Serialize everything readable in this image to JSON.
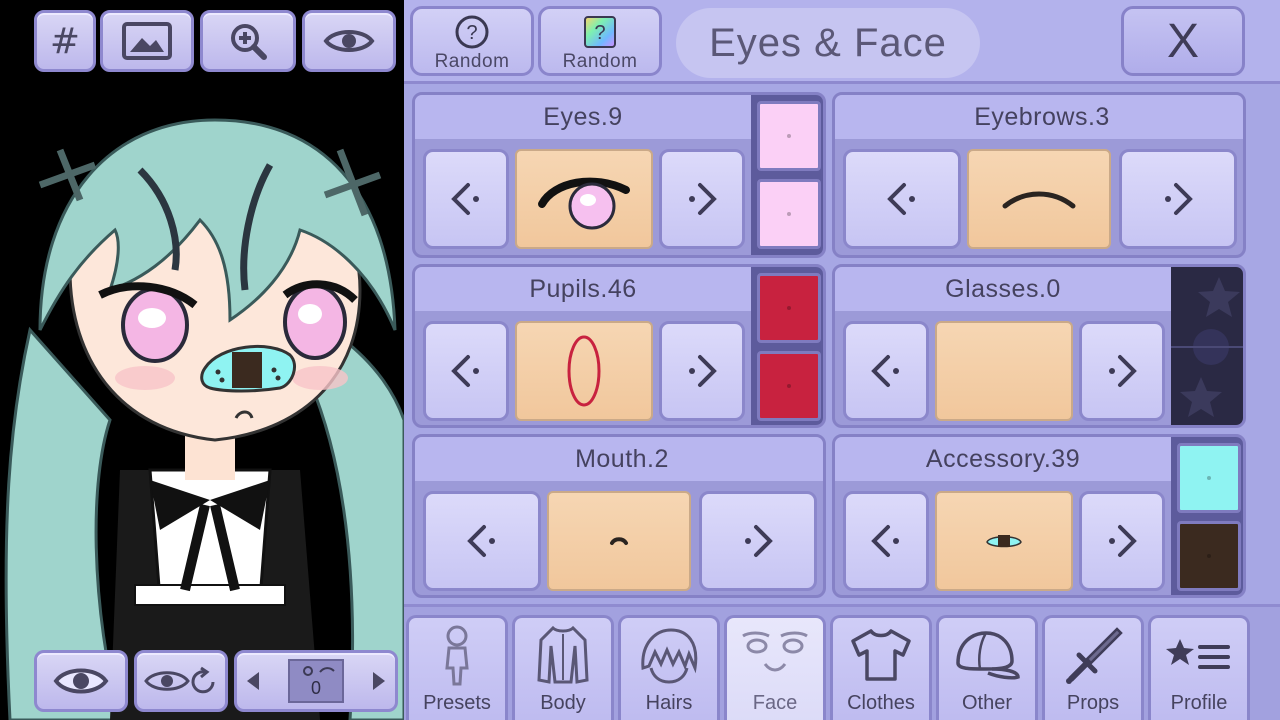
{
  "toolbar": {
    "grid_icon_glyph": "#",
    "icons": [
      "grid-icon",
      "image-icon",
      "zoom-in-icon",
      "eye-icon"
    ]
  },
  "viewport_controls": {
    "icons": [
      "eye-icon",
      "eye-reset-icon"
    ],
    "pose_counter": "0"
  },
  "header": {
    "random_buttons": [
      {
        "label": "Random",
        "icon": "question-circle-icon"
      },
      {
        "label": "Random",
        "icon": "color-random-icon"
      }
    ],
    "title": "Eyes & Face",
    "close_label": "X"
  },
  "features": [
    {
      "label": "Eyes.9",
      "colors": [
        "#fbd0f6",
        "#fbd0f6"
      ]
    },
    {
      "label": "Eyebrows.3",
      "colors": []
    },
    {
      "label": "Pupils.46",
      "colors": [
        "#c8223f",
        "#c8223f"
      ]
    },
    {
      "label": "Glasses.0",
      "colors": [
        "#2a2944"
      ]
    },
    {
      "label": "Mouth.2",
      "colors": []
    },
    {
      "label": "Accessory.39",
      "colors": [
        "#8ff3f2",
        "#3b2a1f"
      ]
    }
  ],
  "tabs": [
    {
      "label": "Presets",
      "icon": "figure-icon",
      "active": false
    },
    {
      "label": "Body",
      "icon": "body-icon",
      "active": false
    },
    {
      "label": "Hairs",
      "icon": "hair-icon",
      "active": false
    },
    {
      "label": "Face",
      "icon": "face-icon",
      "active": true
    },
    {
      "label": "Clothes",
      "icon": "shirt-icon",
      "active": false
    },
    {
      "label": "Other",
      "icon": "cap-icon",
      "active": false
    },
    {
      "label": "Props",
      "icon": "sword-icon",
      "active": false
    },
    {
      "label": "Profile",
      "icon": "star-list-icon",
      "active": false
    }
  ]
}
